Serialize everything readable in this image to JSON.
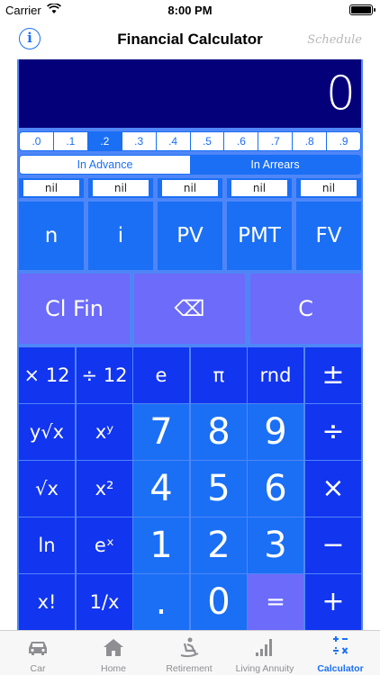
{
  "status": {
    "carrier": "Carrier",
    "time": "8:00 PM"
  },
  "nav": {
    "info": "i",
    "title": "Financial Calculator",
    "schedule": "Schedule"
  },
  "display": {
    "value": "0"
  },
  "decimals": [
    ".0",
    ".1",
    ".2",
    ".3",
    ".4",
    ".5",
    ".6",
    ".7",
    ".8",
    ".9"
  ],
  "decimals_selected": ".2",
  "timing": {
    "advance": "In Advance",
    "arrears": "In Arrears",
    "selected": "In Advance"
  },
  "nil_values": [
    "nil",
    "nil",
    "nil",
    "nil",
    "nil"
  ],
  "fin_keys": [
    "n",
    "i",
    "PV",
    "PMT",
    "FV"
  ],
  "ctrl_keys": {
    "clear_fin": "Cl Fin",
    "backspace": "⌫",
    "clear": "C"
  },
  "keys": {
    "times12": "× 12",
    "div12": "÷ 12",
    "e": "e",
    "pi": "π",
    "rnd": "rnd",
    "plusminus": "±",
    "yroot": "y√x",
    "xpowy": "xʸ",
    "seven": "7",
    "eight": "8",
    "nine": "9",
    "divide": "÷",
    "sqrt": "√x",
    "xsq": "x²",
    "four": "4",
    "five": "5",
    "six": "6",
    "multiply": "×",
    "ln": "ln",
    "epowx": "eˣ",
    "one": "1",
    "two": "2",
    "three": "3",
    "minus": "−",
    "factorial": "x!",
    "reciprocal": "1/x",
    "decimal": ".",
    "zero": "0",
    "equals": "=",
    "plus": "+"
  },
  "tabs": [
    "Car",
    "Home",
    "Retirement",
    "Living Annuity",
    "Calculator"
  ],
  "active_tab": "Calculator",
  "colors": {
    "accent": "#1a6ff5",
    "display_bg": "#04007a",
    "fn_key": "#1235ef",
    "num_key": "#1a6ff5",
    "ctrl_key": "#6d6bfa"
  }
}
